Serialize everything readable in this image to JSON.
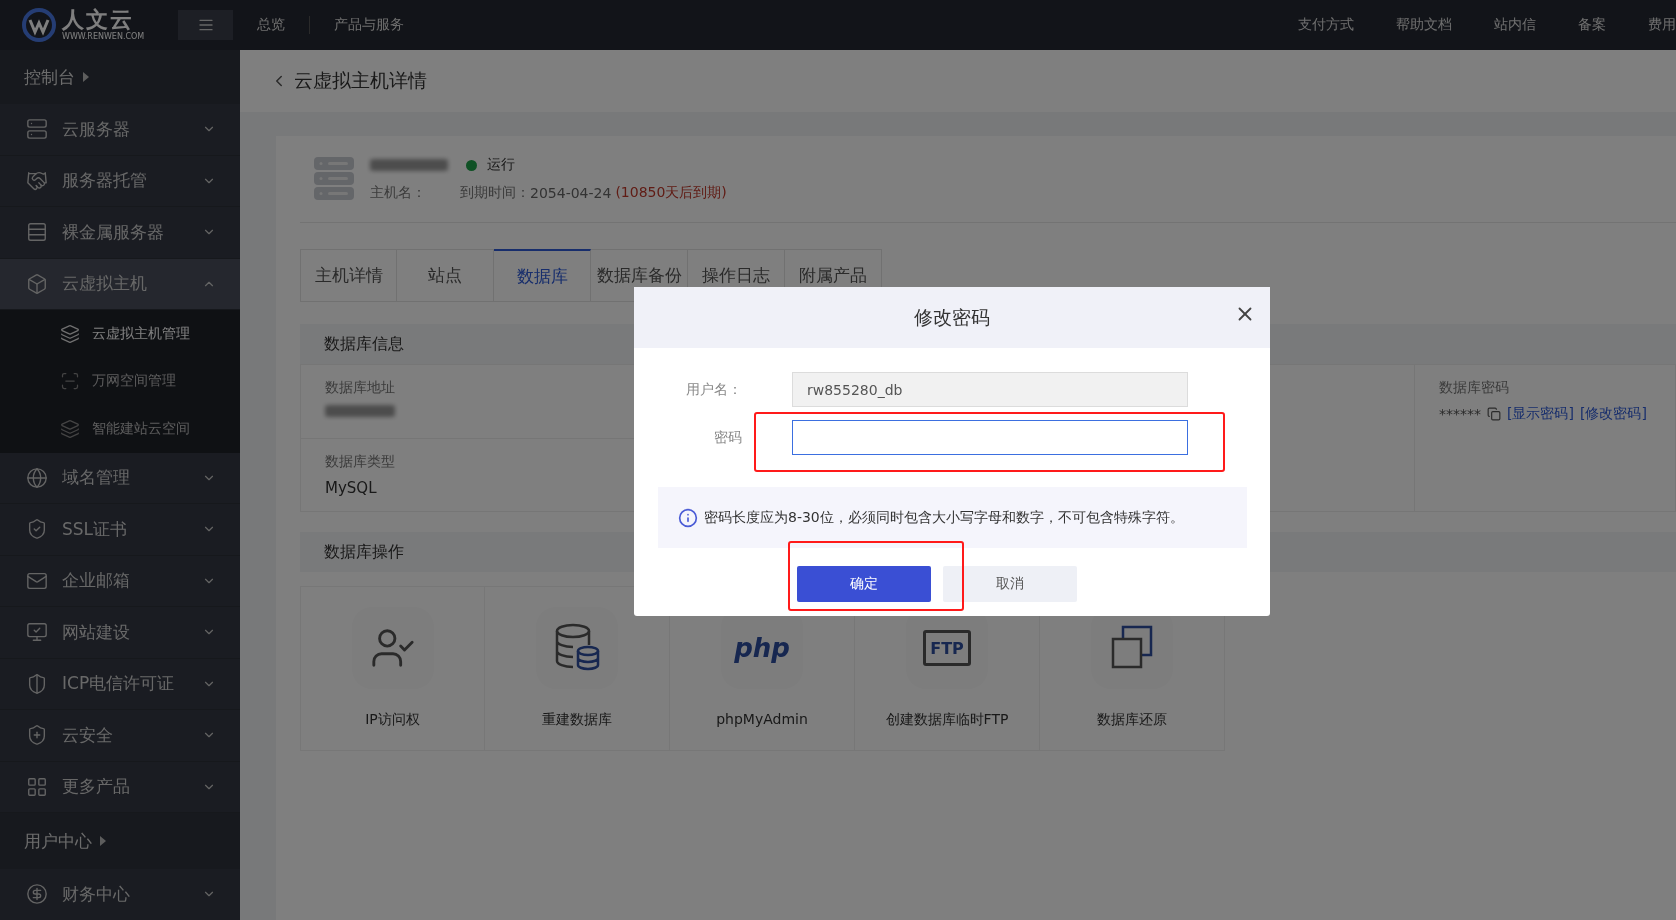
{
  "top_bar": {
    "logo": {
      "name": "人文云",
      "domain": "WWW.RENWEN.COM"
    },
    "nav": [
      "总览",
      "产品与服务"
    ],
    "links": [
      "支付方式",
      "帮助文档",
      "站内信",
      "备案",
      "费用"
    ]
  },
  "sidebar": [
    {
      "kind": "section",
      "label": "控制台"
    },
    {
      "kind": "group",
      "label": "云服务器",
      "expanded": false
    },
    {
      "kind": "group",
      "label": "服务器托管",
      "expanded": false
    },
    {
      "kind": "group",
      "label": "裸金属服务器",
      "expanded": false
    },
    {
      "kind": "group",
      "label": "云虚拟主机",
      "expanded": true,
      "children": [
        {
          "label": "云虚拟主机管理",
          "selected": true
        },
        {
          "label": "万网空间管理",
          "selected": false
        },
        {
          "label": "智能建站云空间",
          "selected": false
        }
      ]
    },
    {
      "kind": "group",
      "label": "域名管理",
      "expanded": false
    },
    {
      "kind": "group",
      "label": "SSL证书",
      "expanded": false
    },
    {
      "kind": "group",
      "label": "企业邮箱",
      "expanded": false
    },
    {
      "kind": "group",
      "label": "网站建设",
      "expanded": false
    },
    {
      "kind": "group",
      "label": "ICP电信许可证",
      "expanded": false
    },
    {
      "kind": "group",
      "label": "云安全",
      "expanded": false
    },
    {
      "kind": "group",
      "label": "更多产品",
      "expanded": false
    },
    {
      "kind": "section",
      "label": "用户中心"
    },
    {
      "kind": "group",
      "label": "财务中心",
      "expanded": false
    }
  ],
  "page": {
    "title": "云虚拟主机详情"
  },
  "host": {
    "status": "运行",
    "running": true,
    "host_label": "主机名：",
    "expiry_label": "到期时间：",
    "expiry_date": "2054-04-24",
    "remaining": "(10850天后到期)"
  },
  "tabs": [
    {
      "label": "主机详情",
      "selected": false
    },
    {
      "label": "站点",
      "selected": false
    },
    {
      "label": "数据库",
      "selected": true
    },
    {
      "label": "数据库备份",
      "selected": false
    },
    {
      "label": "操作日志",
      "selected": false
    },
    {
      "label": "附属产品",
      "selected": false
    }
  ],
  "db_info": {
    "title": "数据库信息",
    "fields": [
      {
        "label": "数据库地址"
      },
      {
        "label": "数据库类型",
        "value": "MySQL"
      }
    ],
    "password": {
      "label": "数据库密码",
      "value": "******",
      "links": [
        "[显示密码]",
        "[修改密码]"
      ]
    }
  },
  "operations": {
    "title": "数据库操作",
    "items": [
      {
        "label": "IP访问权"
      },
      {
        "label": "重建数据库"
      },
      {
        "label": "phpMyAdmin",
        "icon_text": "php"
      },
      {
        "label": "创建数据库临时FTP",
        "icon_text": "FTP"
      },
      {
        "label": "数据库还原"
      }
    ]
  },
  "dialog": {
    "title": "修改密码",
    "fields": [
      {
        "label": "用户名：",
        "value": "rw855280_db",
        "disabled": true,
        "focused": false
      },
      {
        "label": "密码",
        "disabled": false,
        "focused": true
      }
    ],
    "notice": "密码长度应为8-30位，必须同时包含大小写字母和数字，不可包含特殊字符。",
    "buttons": [
      {
        "label": "确定",
        "kind": "primary"
      },
      {
        "label": "取消",
        "kind": "secondary"
      }
    ]
  }
}
